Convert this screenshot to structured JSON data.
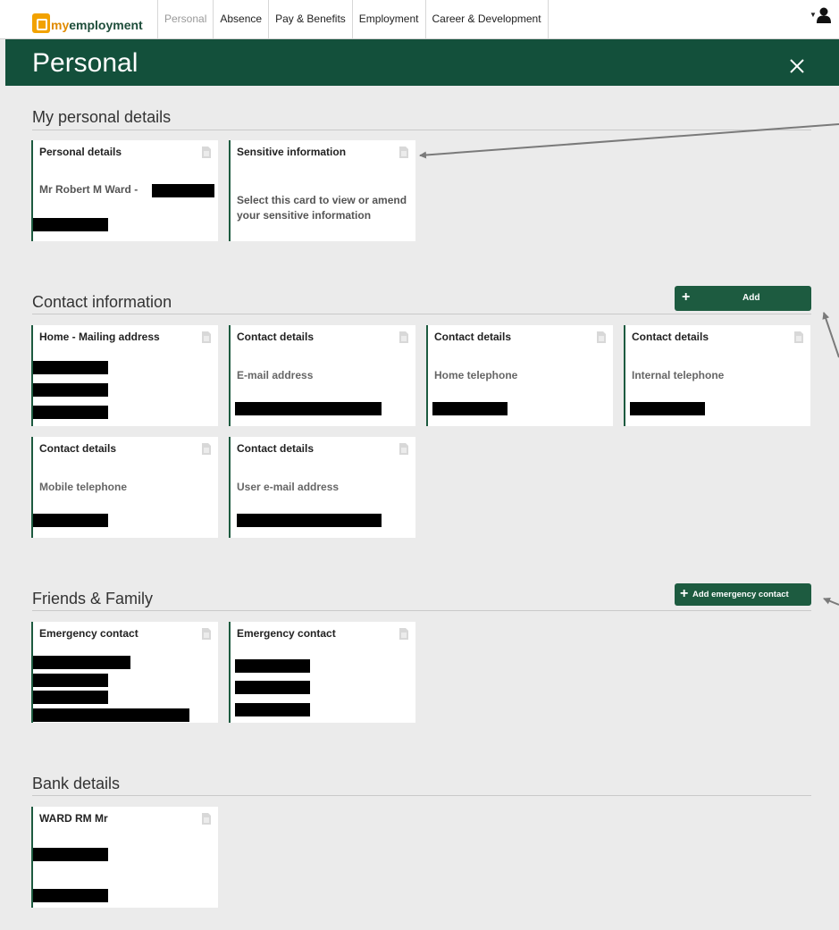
{
  "nav": {
    "logo_text_my": "my",
    "logo_text_rest": "employment",
    "tabs": [
      {
        "label": "Personal",
        "active": true
      },
      {
        "label": "Absence"
      },
      {
        "label": "Pay & Benefits"
      },
      {
        "label": "Employment"
      },
      {
        "label": "Career & Development"
      }
    ]
  },
  "page": {
    "title": "Personal",
    "close_icon": "close-icon"
  },
  "sections": {
    "personal": {
      "title": "My personal details",
      "cards": [
        {
          "title": "Personal details",
          "line1": "Mr Robert M Ward -"
        },
        {
          "title": "Sensitive information",
          "line1": "Select this card to view or amend",
          "line2": "your sensitive information"
        }
      ]
    },
    "contact": {
      "title": "Contact information",
      "add_label": "Add",
      "cards": [
        {
          "title": "Home - Mailing address"
        },
        {
          "title": "Contact details",
          "line1": "E-mail address"
        },
        {
          "title": "Contact details",
          "line1": "Home telephone"
        },
        {
          "title": "Contact details",
          "line1": "Internal telephone"
        },
        {
          "title": "Contact details",
          "line1": "Mobile telephone"
        },
        {
          "title": "Contact details",
          "line1": "User e-mail address"
        }
      ]
    },
    "family": {
      "title": "Friends & Family",
      "add_label": "Add emergency contact",
      "cards": [
        {
          "title": "Emergency contact"
        },
        {
          "title": "Emergency contact"
        }
      ]
    },
    "bank": {
      "title": "Bank details",
      "cards": [
        {
          "title": "WARD RM Mr"
        }
      ]
    }
  },
  "colors": {
    "brand": "#13503b",
    "accent": "#f2a200",
    "card_border": "#1d5b40"
  }
}
